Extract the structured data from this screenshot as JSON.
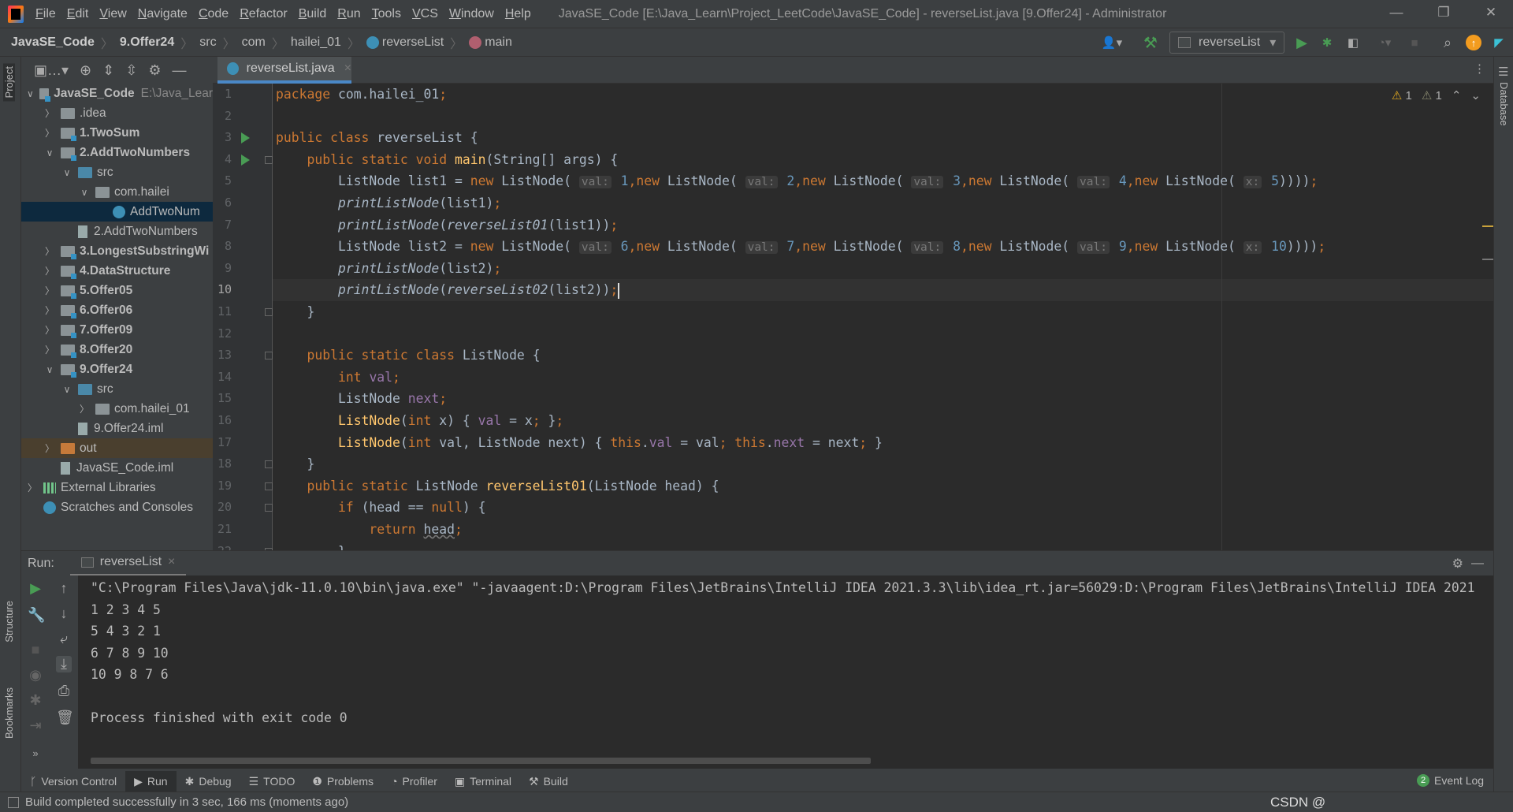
{
  "menu": [
    "File",
    "Edit",
    "View",
    "Navigate",
    "Code",
    "Refactor",
    "Build",
    "Run",
    "Tools",
    "VCS",
    "Window",
    "Help"
  ],
  "window_title": "JavaSE_Code [E:\\Java_Learn\\Project_LeetCode\\JavaSE_Code] - reverseList.java [9.Offer24] - Administrator",
  "breadcrumb": [
    "JavaSE_Code",
    "9.Offer24",
    "src",
    "com",
    "hailei_01",
    "reverseList",
    "main"
  ],
  "run_config": "reverseList",
  "side_labels": {
    "project": "Project",
    "structure": "Structure",
    "bookmarks": "Bookmarks",
    "database": "Database"
  },
  "tree": [
    {
      "label": "JavaSE_Code",
      "extra": "E:\\Java_Lear",
      "level": 0,
      "arrow": "down",
      "icon": "module",
      "bold": true
    },
    {
      "label": ".idea",
      "level": 1,
      "arrow": "right",
      "icon": "folder"
    },
    {
      "label": "1.TwoSum",
      "level": 1,
      "arrow": "right",
      "icon": "module",
      "bold": true
    },
    {
      "label": "2.AddTwoNumbers",
      "level": 1,
      "arrow": "down",
      "icon": "module",
      "bold": true
    },
    {
      "label": "src",
      "level": 2,
      "arrow": "down",
      "icon": "src"
    },
    {
      "label": "com.hailei",
      "level": 3,
      "arrow": "down",
      "icon": "package"
    },
    {
      "label": "AddTwoNum",
      "level": 4,
      "arrow": "none",
      "icon": "class",
      "selected": true
    },
    {
      "label": "2.AddTwoNumbers",
      "level": 2,
      "arrow": "none",
      "icon": "file"
    },
    {
      "label": "3.LongestSubstringWi",
      "level": 1,
      "arrow": "right",
      "icon": "module",
      "bold": true
    },
    {
      "label": "4.DataStructure",
      "level": 1,
      "arrow": "right",
      "icon": "module",
      "bold": true
    },
    {
      "label": "5.Offer05",
      "level": 1,
      "arrow": "right",
      "icon": "module",
      "bold": true
    },
    {
      "label": "6.Offer06",
      "level": 1,
      "arrow": "right",
      "icon": "module",
      "bold": true
    },
    {
      "label": "7.Offer09",
      "level": 1,
      "arrow": "right",
      "icon": "module",
      "bold": true
    },
    {
      "label": "8.Offer20",
      "level": 1,
      "arrow": "right",
      "icon": "module",
      "bold": true
    },
    {
      "label": "9.Offer24",
      "level": 1,
      "arrow": "down",
      "icon": "module",
      "bold": true
    },
    {
      "label": "src",
      "level": 2,
      "arrow": "down",
      "icon": "src"
    },
    {
      "label": "com.hailei_01",
      "level": 3,
      "arrow": "right",
      "icon": "package"
    },
    {
      "label": "9.Offer24.iml",
      "level": 2,
      "arrow": "none",
      "icon": "file"
    },
    {
      "label": "out",
      "level": 1,
      "arrow": "right",
      "icon": "orange",
      "highlight": true
    },
    {
      "label": "JavaSE_Code.iml",
      "level": 1,
      "arrow": "none",
      "icon": "file"
    },
    {
      "label": "External Libraries",
      "level": 0,
      "arrow": "right",
      "icon": "libs"
    },
    {
      "label": "Scratches and Consoles",
      "level": 0,
      "arrow": "none",
      "icon": "scratch"
    }
  ],
  "editor_tab": "reverseList.java",
  "inspections": {
    "warnings": "1",
    "weak_warnings": "1"
  },
  "current_line": 10,
  "code": [
    [
      [
        "kw",
        "package "
      ],
      [
        "",
        "com.hailei_01"
      ],
      [
        "kw",
        ";"
      ]
    ],
    [],
    [
      [
        "kw",
        "public class "
      ],
      [
        "",
        "reverseList {"
      ]
    ],
    [
      [
        "",
        "    "
      ],
      [
        "kw",
        "public static void "
      ],
      [
        "fn",
        "main"
      ],
      [
        "",
        "(String[] args) {"
      ]
    ],
    [
      [
        "",
        "        ListNode list1 = "
      ],
      [
        "kw",
        "new "
      ],
      [
        "",
        "ListNode( "
      ],
      [
        "hint",
        "val:"
      ],
      [
        "num",
        " 1"
      ],
      [
        "kw",
        ","
      ],
      [
        "kw",
        "new "
      ],
      [
        "",
        "ListNode( "
      ],
      [
        "hint",
        "val:"
      ],
      [
        "num",
        " 2"
      ],
      [
        "kw",
        ","
      ],
      [
        "kw",
        "new "
      ],
      [
        "",
        "ListNode( "
      ],
      [
        "hint",
        "val:"
      ],
      [
        "num",
        " 3"
      ],
      [
        "kw",
        ","
      ],
      [
        "kw",
        "new "
      ],
      [
        "",
        "ListNode( "
      ],
      [
        "hint",
        "val:"
      ],
      [
        "num",
        " 4"
      ],
      [
        "kw",
        ","
      ],
      [
        "kw",
        "new "
      ],
      [
        "",
        "ListNode( "
      ],
      [
        "hint",
        "x:"
      ],
      [
        "num",
        " 5"
      ],
      [
        "",
        "))))"
      ],
      [
        "kw",
        ";"
      ]
    ],
    [
      [
        "",
        "        "
      ],
      [
        "it",
        "printListNode"
      ],
      [
        "",
        "(list1)"
      ],
      [
        "kw",
        ";"
      ]
    ],
    [
      [
        "",
        "        "
      ],
      [
        "it",
        "printListNode"
      ],
      [
        "",
        "("
      ],
      [
        "it",
        "reverseList01"
      ],
      [
        "",
        "(list1))"
      ],
      [
        "kw",
        ";"
      ]
    ],
    [
      [
        "",
        "        ListNode list2 = "
      ],
      [
        "kw",
        "new "
      ],
      [
        "",
        "ListNode( "
      ],
      [
        "hint",
        "val:"
      ],
      [
        "num",
        " 6"
      ],
      [
        "kw",
        ","
      ],
      [
        "kw",
        "new "
      ],
      [
        "",
        "ListNode( "
      ],
      [
        "hint",
        "val:"
      ],
      [
        "num",
        " 7"
      ],
      [
        "kw",
        ","
      ],
      [
        "kw",
        "new "
      ],
      [
        "",
        "ListNode( "
      ],
      [
        "hint",
        "val:"
      ],
      [
        "num",
        " 8"
      ],
      [
        "kw",
        ","
      ],
      [
        "kw",
        "new "
      ],
      [
        "",
        "ListNode( "
      ],
      [
        "hint",
        "val:"
      ],
      [
        "num",
        " 9"
      ],
      [
        "kw",
        ","
      ],
      [
        "kw",
        "new "
      ],
      [
        "",
        "ListNode( "
      ],
      [
        "hint",
        "x:"
      ],
      [
        "num",
        " 10"
      ],
      [
        "",
        "))))"
      ],
      [
        "kw",
        ";"
      ]
    ],
    [
      [
        "",
        "        "
      ],
      [
        "it",
        "printListNode"
      ],
      [
        "",
        "(list2)"
      ],
      [
        "kw",
        ";"
      ]
    ],
    [
      [
        "",
        "        "
      ],
      [
        "it",
        "printListNode"
      ],
      [
        "",
        "("
      ],
      [
        "it",
        "reverseList02"
      ],
      [
        "",
        "(list2))"
      ],
      [
        "kw",
        ";"
      ],
      [
        "caret",
        ""
      ]
    ],
    [
      [
        "",
        "    }"
      ]
    ],
    [],
    [
      [
        "",
        "    "
      ],
      [
        "kw",
        "public static class "
      ],
      [
        "",
        "ListNode {"
      ]
    ],
    [
      [
        "",
        "        "
      ],
      [
        "kw",
        "int "
      ],
      [
        "fld",
        "val"
      ],
      [
        "kw",
        ";"
      ]
    ],
    [
      [
        "",
        "        ListNode "
      ],
      [
        "fld",
        "next"
      ],
      [
        "kw",
        ";"
      ]
    ],
    [
      [
        "",
        "        "
      ],
      [
        "fn",
        "ListNode"
      ],
      [
        "",
        "("
      ],
      [
        "kw",
        "int "
      ],
      [
        "",
        "x) { "
      ],
      [
        "fld",
        "val "
      ],
      [
        "",
        "= x"
      ],
      [
        "kw",
        "; "
      ],
      [
        "",
        "}"
      ],
      [
        "kw",
        ";"
      ]
    ],
    [
      [
        "",
        "        "
      ],
      [
        "fn",
        "ListNode"
      ],
      [
        "",
        "("
      ],
      [
        "kw",
        "int "
      ],
      [
        "",
        "val, ListNode next) { "
      ],
      [
        "kw",
        "this"
      ],
      [
        "",
        "."
      ],
      [
        "fld",
        "val "
      ],
      [
        "",
        "= val"
      ],
      [
        "kw",
        "; this"
      ],
      [
        "",
        "."
      ],
      [
        "fld",
        "next "
      ],
      [
        "",
        "= next"
      ],
      [
        "kw",
        "; "
      ],
      [
        "",
        "}"
      ]
    ],
    [
      [
        "",
        "    }"
      ]
    ],
    [
      [
        "",
        "    "
      ],
      [
        "kw",
        "public static "
      ],
      [
        "",
        "ListNode "
      ],
      [
        "fn",
        "reverseList01"
      ],
      [
        "",
        "(ListNode head) {"
      ]
    ],
    [
      [
        "",
        "        "
      ],
      [
        "kw",
        "if "
      ],
      [
        "",
        "(head == "
      ],
      [
        "kw",
        "null"
      ],
      [
        "",
        ") {"
      ]
    ],
    [
      [
        "",
        "            "
      ],
      [
        "kw",
        "return "
      ],
      [
        "uline",
        "head"
      ],
      [
        "kw",
        ";"
      ]
    ],
    [
      [
        "",
        "        }"
      ]
    ]
  ],
  "run": {
    "label": "Run:",
    "tab": "reverseList",
    "output": [
      "\"C:\\Program Files\\Java\\jdk-11.0.10\\bin\\java.exe\" \"-javaagent:D:\\Program Files\\JetBrains\\IntelliJ IDEA 2021.3.3\\lib\\idea_rt.jar=56029:D:\\Program Files\\JetBrains\\IntelliJ IDEA 2021",
      "1 2 3 4 5",
      "5 4 3 2 1",
      "6 7 8 9 10",
      "10 9 8 7 6",
      "",
      "Process finished with exit code 0"
    ]
  },
  "bottom_tools": [
    "Version Control",
    "Run",
    "Debug",
    "TODO",
    "Problems",
    "Profiler",
    "Terminal",
    "Build"
  ],
  "event_log": {
    "label": "Event Log",
    "count": "2"
  },
  "status": "Build completed successfully in 3 sec, 166 ms (moments ago)",
  "watermark": "CSDN @"
}
